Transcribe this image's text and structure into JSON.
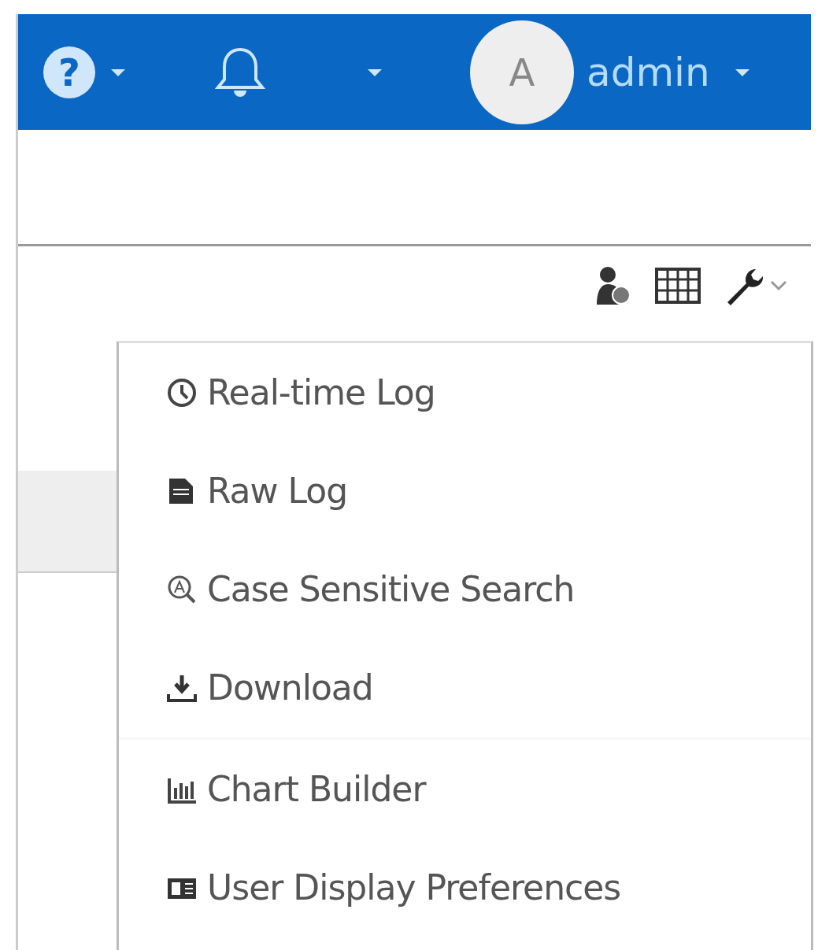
{
  "header": {
    "help_glyph": "?",
    "avatar_letter": "A",
    "user": "admin"
  },
  "menu": {
    "groups": [
      [
        {
          "label": "Real-time Log"
        },
        {
          "label": "Raw Log"
        },
        {
          "label": "Case Sensitive Search"
        },
        {
          "label": "Download"
        }
      ],
      [
        {
          "label": "Chart Builder"
        },
        {
          "label": "User Display Preferences"
        }
      ]
    ]
  }
}
